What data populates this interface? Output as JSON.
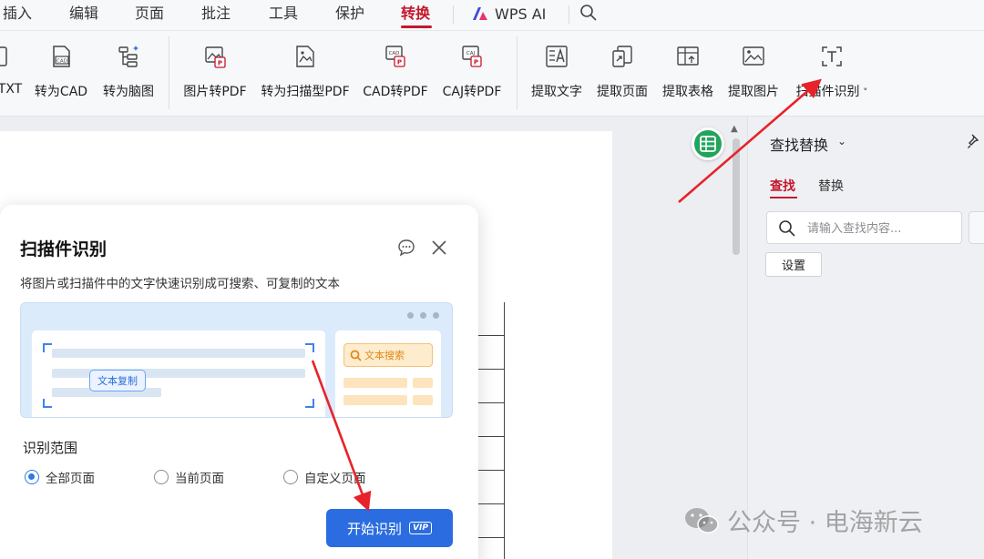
{
  "menubar": {
    "items": [
      "插入",
      "编辑",
      "页面",
      "批注",
      "工具",
      "保护",
      "转换"
    ],
    "active": "转换",
    "wps_ai_label": "WPS AI"
  },
  "ribbon": {
    "buttons": [
      {
        "label": "TXT",
        "icon": "txt-icon"
      },
      {
        "label": "转为CAD",
        "icon": "cad-icon"
      },
      {
        "label": "转为脑图",
        "icon": "mindmap-icon"
      },
      {
        "label": "图片转PDF",
        "icon": "image-to-pdf-icon"
      },
      {
        "label": "转为扫描型PDF",
        "icon": "scan-pdf-icon"
      },
      {
        "label": "CAD转PDF",
        "icon": "cad-to-pdf-icon"
      },
      {
        "label": "CAJ转PDF",
        "icon": "caj-to-pdf-icon"
      },
      {
        "label": "提取文字",
        "icon": "extract-text-icon"
      },
      {
        "label": "提取页面",
        "icon": "extract-page-icon"
      },
      {
        "label": "提取表格",
        "icon": "extract-table-icon"
      },
      {
        "label": "提取图片",
        "icon": "extract-image-icon"
      },
      {
        "label": "扫描件识别",
        "icon": "scan-ocr-icon"
      }
    ]
  },
  "find_pane": {
    "title": "查找替换",
    "tab_find": "查找",
    "tab_replace": "替换",
    "search_placeholder": "请输入查找内容...",
    "settings_label": "设置"
  },
  "dialog": {
    "title": "扫描件识别",
    "description": "将图片或扫描件中的文字快速识别成可搜索、可复制的文本",
    "preview_copy_tag": "文本复制",
    "preview_search_tag": "文本搜索",
    "range_label": "识别范围",
    "options": [
      {
        "label": "全部页面",
        "checked": true
      },
      {
        "label": "当前页面",
        "checked": false
      },
      {
        "label": "自定义页面",
        "checked": false
      }
    ],
    "start_button": "开始识别",
    "vip_badge": "VIP"
  },
  "watermark": "公众号 · 电海新云",
  "colors": {
    "accent_red": "#c4172c",
    "primary_blue": "#2b6de0",
    "annotation_arrow": "#e8222a"
  }
}
